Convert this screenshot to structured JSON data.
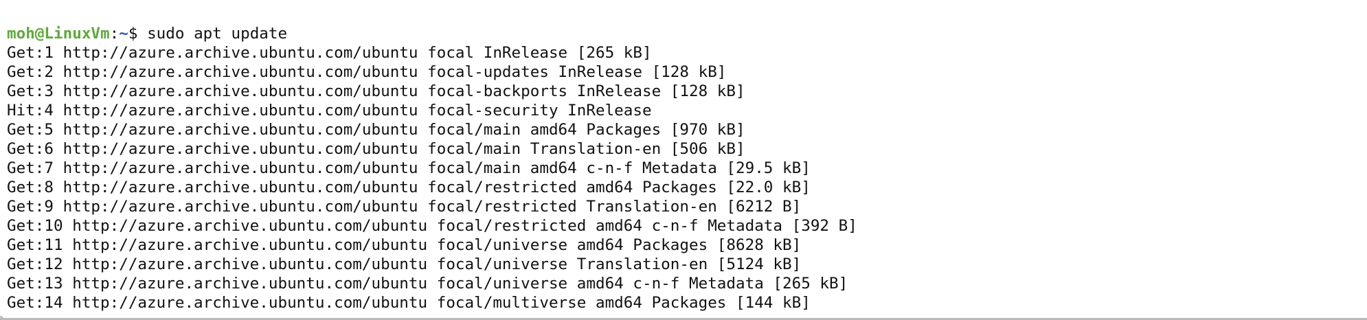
{
  "terminal": {
    "prompt": {
      "user_host": "moh@LinuxVm",
      "separator": ":",
      "path": "~",
      "symbol": "$",
      "command": " sudo apt update"
    },
    "output_lines": [
      "Get:1 http://azure.archive.ubuntu.com/ubuntu focal InRelease [265 kB]",
      "Get:2 http://azure.archive.ubuntu.com/ubuntu focal-updates InRelease [128 kB]",
      "Get:3 http://azure.archive.ubuntu.com/ubuntu focal-backports InRelease [128 kB]",
      "Hit:4 http://azure.archive.ubuntu.com/ubuntu focal-security InRelease",
      "Get:5 http://azure.archive.ubuntu.com/ubuntu focal/main amd64 Packages [970 kB]",
      "Get:6 http://azure.archive.ubuntu.com/ubuntu focal/main Translation-en [506 kB]",
      "Get:7 http://azure.archive.ubuntu.com/ubuntu focal/main amd64 c-n-f Metadata [29.5 kB]",
      "Get:8 http://azure.archive.ubuntu.com/ubuntu focal/restricted amd64 Packages [22.0 kB]",
      "Get:9 http://azure.archive.ubuntu.com/ubuntu focal/restricted Translation-en [6212 B]",
      "Get:10 http://azure.archive.ubuntu.com/ubuntu focal/restricted amd64 c-n-f Metadata [392 B]",
      "Get:11 http://azure.archive.ubuntu.com/ubuntu focal/universe amd64 Packages [8628 kB]",
      "Get:12 http://azure.archive.ubuntu.com/ubuntu focal/universe Translation-en [5124 kB]",
      "Get:13 http://azure.archive.ubuntu.com/ubuntu focal/universe amd64 c-n-f Metadata [265 kB]",
      "Get:14 http://azure.archive.ubuntu.com/ubuntu focal/multiverse amd64 Packages [144 kB]"
    ],
    "colors": {
      "background": "#ffffff",
      "text": "#111111",
      "prompt_user": "#5fa93a",
      "prompt_path": "#2f52c9"
    }
  }
}
